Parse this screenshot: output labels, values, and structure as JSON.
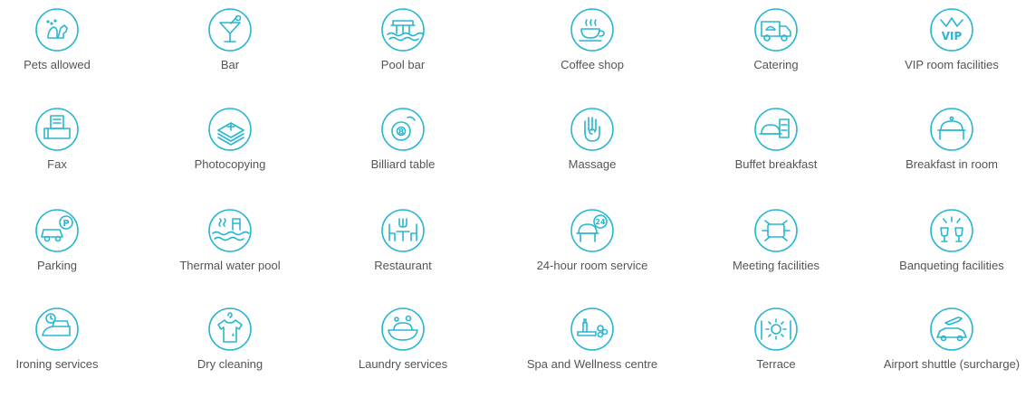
{
  "accent_color": "#29b6d2",
  "label_color": "#555555",
  "facilities": [
    {
      "label": "Pets allowed",
      "icon": "pets-icon"
    },
    {
      "label": "Bar",
      "icon": "cocktail-icon"
    },
    {
      "label": "Pool bar",
      "icon": "pool-bar-icon"
    },
    {
      "label": "Coffee shop",
      "icon": "coffee-cup-icon"
    },
    {
      "label": "Catering",
      "icon": "catering-truck-icon"
    },
    {
      "label": "VIP room facilities",
      "icon": "vip-crown-icon"
    },
    {
      "label": "Fax",
      "icon": "fax-icon"
    },
    {
      "label": "Photocopying",
      "icon": "photocopy-icon"
    },
    {
      "label": "Billiard table",
      "icon": "billiard-ball-icon"
    },
    {
      "label": "Massage",
      "icon": "massage-hand-icon"
    },
    {
      "label": "Buffet breakfast",
      "icon": "buffet-icon"
    },
    {
      "label": "Breakfast in room",
      "icon": "room-service-tray-icon"
    },
    {
      "label": "Parking",
      "icon": "parking-icon"
    },
    {
      "label": "Thermal water pool",
      "icon": "thermal-pool-icon"
    },
    {
      "label": "Restaurant",
      "icon": "restaurant-icon"
    },
    {
      "label": "24-hour room service",
      "icon": "24h-service-icon"
    },
    {
      "label": "Meeting facilities",
      "icon": "meeting-table-icon"
    },
    {
      "label": "Banqueting facilities",
      "icon": "banquet-glasses-icon"
    },
    {
      "label": "Ironing services",
      "icon": "iron-icon"
    },
    {
      "label": "Dry cleaning",
      "icon": "shirt-hanger-icon"
    },
    {
      "label": "Laundry services",
      "icon": "laundry-basin-icon"
    },
    {
      "label": "Spa and Wellness centre",
      "icon": "spa-icon"
    },
    {
      "label": "Terrace",
      "icon": "terrace-sun-icon"
    },
    {
      "label": "Airport shuttle (surcharge)",
      "icon": "airport-shuttle-icon"
    }
  ],
  "glyphs": {
    "vip": "VIP",
    "billiard": "8",
    "parking": "P",
    "hours": "24"
  }
}
